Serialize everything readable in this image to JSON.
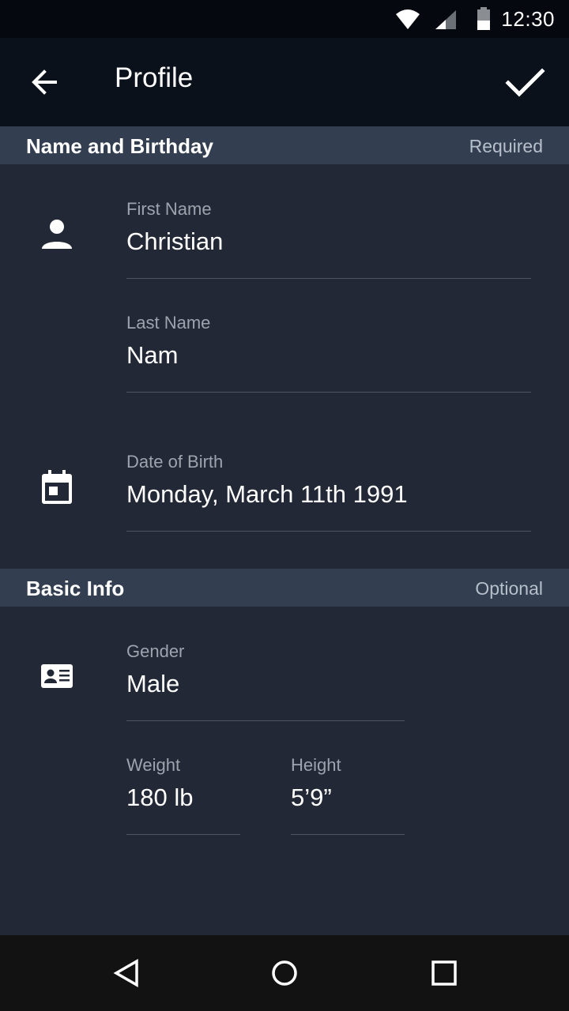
{
  "status_bar": {
    "time": "12:30",
    "icons": [
      "wifi-icon",
      "signal-icon",
      "battery-icon"
    ]
  },
  "app_bar": {
    "title": "Profile",
    "back_icon": "arrow-back-icon",
    "confirm_icon": "check-icon"
  },
  "sections": {
    "name_birthday": {
      "title": "Name and Birthday",
      "tag": "Required",
      "fields": {
        "first_name": {
          "label": "First Name",
          "value": "Christian"
        },
        "last_name": {
          "label": "Last Name",
          "value": "Nam"
        },
        "date_of_birth": {
          "label": "Date of Birth",
          "value": "Monday, March 11th 1991"
        }
      }
    },
    "basic_info": {
      "title": "Basic Info",
      "tag": "Optional",
      "fields": {
        "gender": {
          "label": "Gender",
          "value": "Male"
        },
        "weight": {
          "label": "Weight",
          "value": "180 lb"
        },
        "height": {
          "label": "Height",
          "value": "5’9”"
        }
      }
    }
  },
  "nav_bar": {
    "icons": [
      "nav-back-icon",
      "nav-home-icon",
      "nav-recents-icon"
    ]
  },
  "colors": {
    "background": "#222835",
    "app_bar": "#0a111b",
    "section_header": "#333f51",
    "label": "#9ea4ae",
    "divider": "#4d5564"
  }
}
